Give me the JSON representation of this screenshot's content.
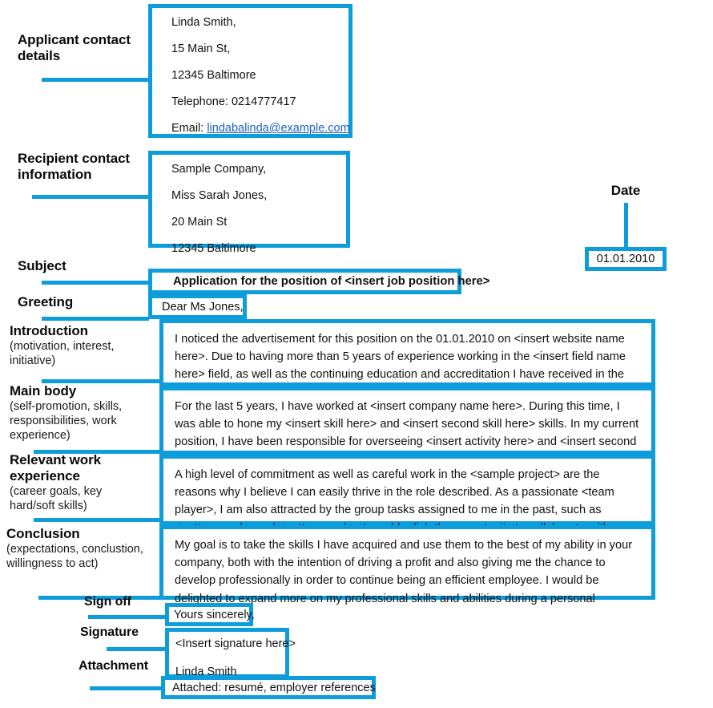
{
  "meta": {
    "accent_color": "#0d9ddb",
    "link_color": "#1c62c4",
    "text_color": "#111111"
  },
  "annotations": {
    "applicant": {
      "title": "Applicant contact",
      "title2": "details"
    },
    "recipient": {
      "title": "Recipient contact",
      "title2": "information"
    },
    "date": {
      "title": "Date"
    },
    "subject": {
      "title": "Subject"
    },
    "greeting": {
      "title": "Greeting"
    },
    "introduction": {
      "title": "Introduction",
      "sub1": "(motivation, interest,",
      "sub2": "initiative)"
    },
    "main_body": {
      "title": "Main body",
      "sub1": "(self-promotion, skills,",
      "sub2": "responsibilities, work",
      "sub3": "experience)"
    },
    "relevant_experience": {
      "title": "Relevant work",
      "title2": "experience",
      "sub1": "(career goals, key",
      "sub2": "hard/soft skills)"
    },
    "conclusion": {
      "title": "Conclusion",
      "sub1": "(expectations, conclustion,",
      "sub2": "willingness to act)"
    },
    "sign_off": {
      "title": "Sign off"
    },
    "signature": {
      "title": "Signature"
    },
    "attachment": {
      "title": "Attachment"
    }
  },
  "letter": {
    "applicant_contact": {
      "name": "Linda Smith,",
      "street": "15 Main St,",
      "city": "12345 Baltimore",
      "telephone": "Telephone: 0214777417",
      "email_label": "Email:",
      "email": "lindabalinda@example.com"
    },
    "recipient_contact": {
      "company": "Sample Company,",
      "person": "Miss Sarah Jones,",
      "street": "20 Main St",
      "city": "12345 Baltimore"
    },
    "date_value": "01.01.2010",
    "subject_value": "Application for the position of <insert job position here>",
    "greeting_value": "Dear Ms Jones,",
    "introduction_text": "I noticed the advertisement for this position on the 01.01.2010 on <insert website name here>. Due to having more than 5 years of experience working in the <insert field name here> field, as well as the continuing education and accreditation I have received in the field, I believe I would be an ideal candidate for the opening advertised.",
    "main_body_text": "For the last 5 years, I have worked at <insert company name here>. During this time, I was able to hone my <insert skill here> and <insert second skill here> skills. In my current position, I have been responsible for overseeing <insert activity here> and <insert second activity here> which have been invaluable in understanding the structure and inner workings of the industry.",
    "relevant_experience_text": "A high level of commitment as well as careful work in the <sample project> are the reasons why I believe I can easily thrive in the role described. As a passionate <team player>, I am also attracted by the group tasks assigned to me in the past, such as <pattern work> and <pattern work>. I would relish the opportunity to collaborate with a team again in the position advertised.",
    "conclusion_text": "My goal is to take the skills I have acquired and use them to the best of my ability in your company, both with the intention of driving a profit and also giving me the chance to develop professionally in order to continue being an efficient employee. I would be delighted to expand more on my professional skills and abilities during a personal interview.",
    "sign_off_value": "Yours sincerely,",
    "signature_placeholder": "<Insert signature here>",
    "signature_name": "Linda Smith",
    "attachment_value": "Attached: resumé, employer references"
  }
}
